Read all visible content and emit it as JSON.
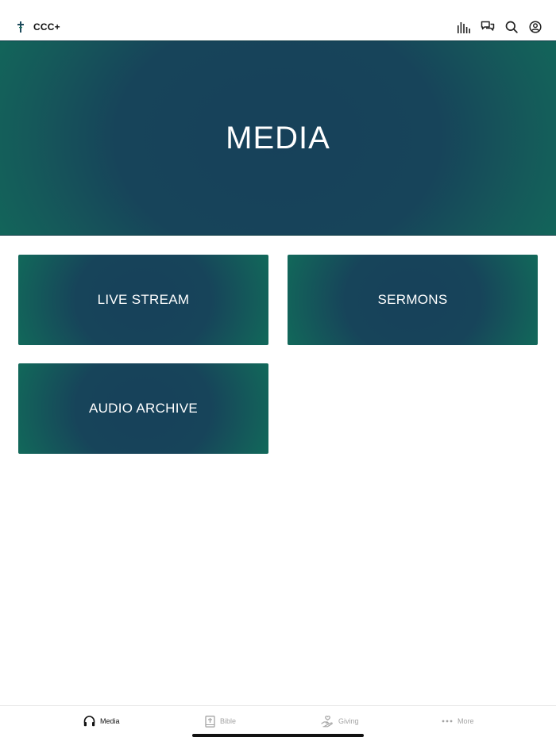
{
  "app": {
    "brand_name": "CCC+",
    "brand_icon": "cross-icon"
  },
  "header": {
    "icons": [
      "audio-bars-icon",
      "chat-icon",
      "search-icon",
      "account-icon"
    ]
  },
  "hero": {
    "title": "MEDIA"
  },
  "tiles": [
    {
      "label": "LIVE STREAM"
    },
    {
      "label": "SERMONS"
    },
    {
      "label": "AUDIO ARCHIVE"
    }
  ],
  "tabbar": {
    "items": [
      {
        "label": "Media",
        "icon": "headphones-icon",
        "active": true
      },
      {
        "label": "Bible",
        "icon": "bible-icon",
        "active": false
      },
      {
        "label": "Giving",
        "icon": "giving-hand-icon",
        "active": false
      },
      {
        "label": "More",
        "icon": "more-dots-icon",
        "active": false
      }
    ]
  },
  "colors": {
    "tile_center": "#17415a",
    "tile_edge": "#10705a",
    "active_tab": "#111111",
    "inactive_tab": "#a4a4a4"
  }
}
